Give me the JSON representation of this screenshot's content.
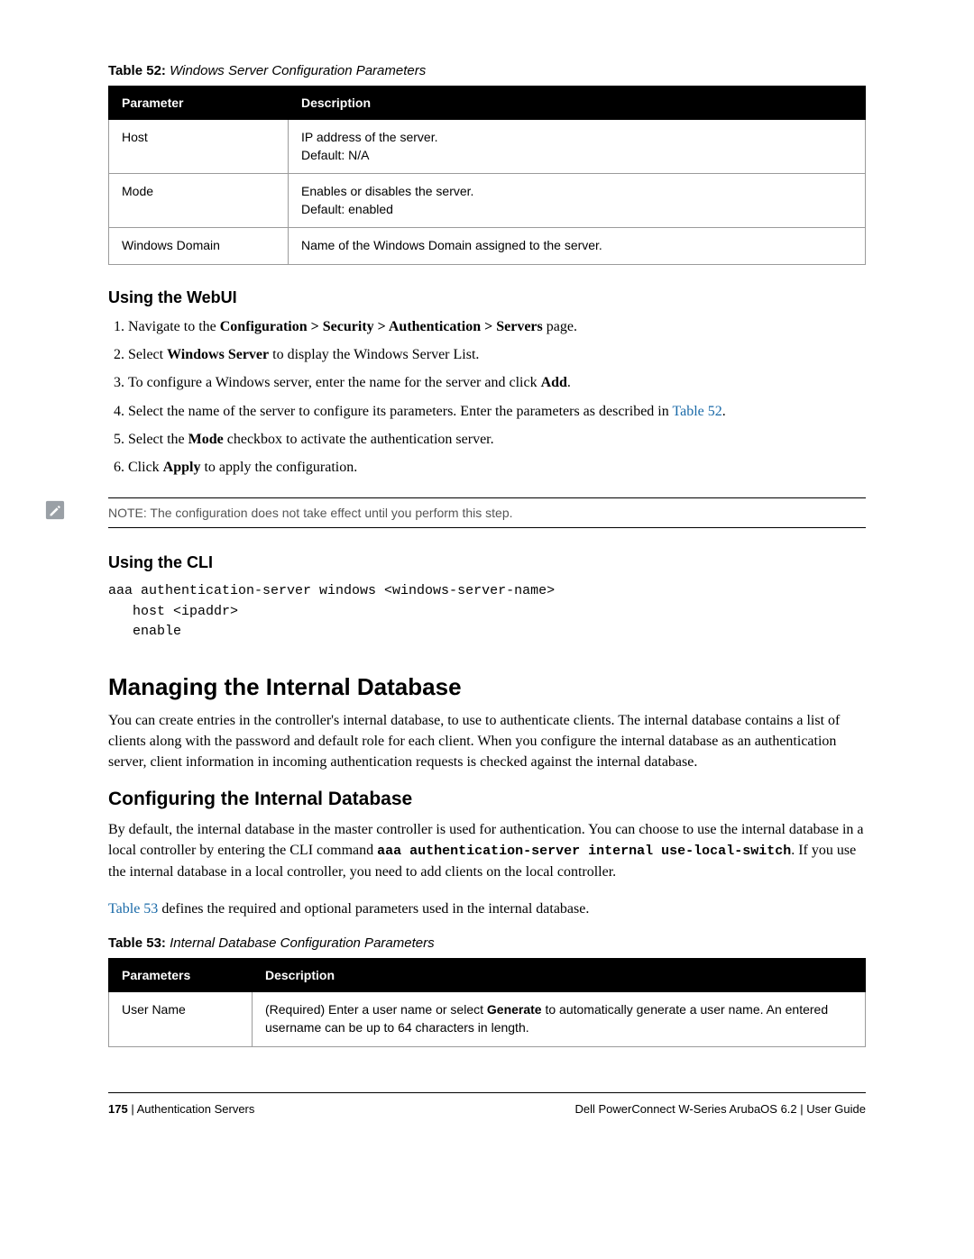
{
  "table52": {
    "caption_bold": "Table 52:",
    "caption_italic": " Windows Server Configuration Parameters",
    "headers": {
      "c0": "Parameter",
      "c1": "Description"
    },
    "rows": [
      {
        "c0": "Host",
        "c1": "IP address of the server.\nDefault: N/A"
      },
      {
        "c0": "Mode",
        "c1": "Enables or disables the server.\nDefault: enabled"
      },
      {
        "c0": "Windows Domain",
        "c1": "Name of the Windows Domain assigned to the server."
      }
    ]
  },
  "webui": {
    "heading": "Using the WebUI",
    "steps": {
      "s1_pre": "Navigate to the ",
      "s1_bold": "Configuration > Security > Authentication > Servers",
      "s1_post": " page.",
      "s2_pre": "Select ",
      "s2_bold": "Windows Server",
      "s2_post": " to display the Windows Server List.",
      "s3_pre": "To configure a Windows server, enter the name for the server and click ",
      "s3_bold": "Add",
      "s3_post": ".",
      "s4_pre": "Select the name of the server to configure its parameters. Enter the parameters as described in ",
      "s4_link": "Table 52",
      "s4_post": ".",
      "s5_pre": "Select the ",
      "s5_bold": "Mode",
      "s5_post": " checkbox to activate the authentication server.",
      "s6_pre": "Click ",
      "s6_bold": "Apply",
      "s6_post": " to apply the configuration."
    }
  },
  "note": "NOTE: The configuration does not take effect until you perform this step.",
  "cli": {
    "heading": "Using the CLI",
    "code": "aaa authentication-server windows <windows-server-name>\n   host <ipaddr>\n   enable"
  },
  "h1": "Managing the Internal Database",
  "p1": "You can create entries in the controller's internal database, to use to authenticate clients. The internal database contains a list of clients along with the password and default role for each client. When you configure the internal database as an authentication server, client information in incoming authentication requests is checked against the internal database.",
  "h2": "Configuring the Internal Database",
  "p2_pre": "By default, the internal database in the master controller is used for authentication. You can choose to use the internal database in a local controller by entering the CLI command ",
  "p2_mono": "aaa authentication-server internal use-local-switch",
  "p2_post": ". If you use the internal database in a local controller, you need to add clients on the local controller.",
  "p3_link": "Table 53",
  "p3_post": " defines the required and optional parameters used in the internal database.",
  "table53": {
    "caption_bold": "Table 53:",
    "caption_italic": " Internal Database Configuration Parameters",
    "headers": {
      "c0": "Parameters",
      "c1": "Description"
    },
    "row0": {
      "c0": "User Name",
      "c1_pre": "(Required) Enter a user name or select ",
      "c1_bold": "Generate",
      "c1_post": " to automatically generate a user name. An entered username can be up to 64 characters in length."
    }
  },
  "footer": {
    "page": "175",
    "left_sep": " | ",
    "left_chapter": "Authentication Servers",
    "right": "Dell PowerConnect W-Series ArubaOS 6.2  |  User Guide"
  }
}
